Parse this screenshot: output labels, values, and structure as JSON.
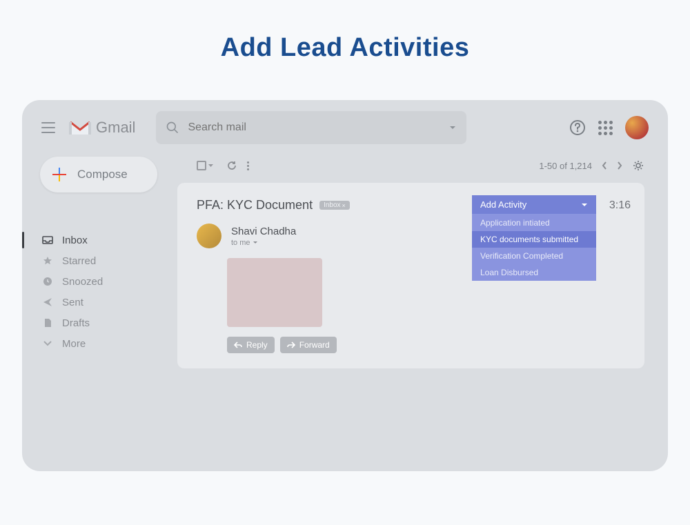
{
  "page": {
    "title": "Add Lead Activities"
  },
  "header": {
    "logo_text": "Gmail",
    "search_placeholder": "Search mail"
  },
  "sidebar": {
    "compose_label": "Compose",
    "items": [
      {
        "label": "Inbox",
        "icon": "inbox-icon",
        "active": true
      },
      {
        "label": "Starred",
        "icon": "star-icon",
        "active": false
      },
      {
        "label": "Snoozed",
        "icon": "clock-icon",
        "active": false
      },
      {
        "label": "Sent",
        "icon": "send-icon",
        "active": false
      },
      {
        "label": "Drafts",
        "icon": "file-icon",
        "active": false
      },
      {
        "label": "More",
        "icon": "chevron-down-icon",
        "active": false
      }
    ]
  },
  "toolbar": {
    "page_info": "1-50 of 1,214"
  },
  "email": {
    "subject": "PFA: KYC Document",
    "tag_label": "Inbox",
    "time": "3:16",
    "sender_name": "Shavi Chadha",
    "recipient": "to me",
    "reply_label": "Reply",
    "forward_label": "Forward"
  },
  "dropdown": {
    "header": "Add Activity",
    "options": [
      {
        "label": "Application intiated",
        "highlighted": false
      },
      {
        "label": "KYC documents submitted",
        "highlighted": true
      },
      {
        "label": "Verification Completed",
        "highlighted": false
      },
      {
        "label": "Loan Disbursed",
        "highlighted": false
      }
    ]
  },
  "colors": {
    "title": "#1a4d8f",
    "dropdown_bg": "#8a94df",
    "dropdown_header": "#7481d6",
    "dropdown_highlight": "#6d7ad2"
  }
}
